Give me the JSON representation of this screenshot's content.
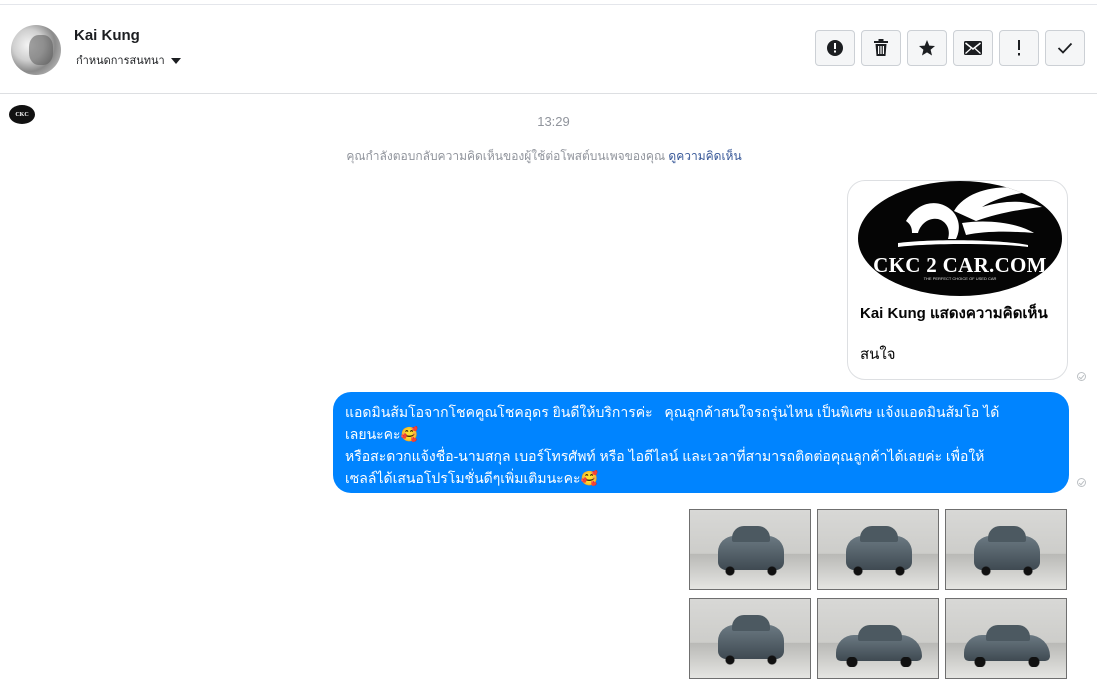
{
  "header": {
    "contact_name": "Kai Kung",
    "subtitle": "กำหนดการสนทนา",
    "actions": [
      {
        "icon": "alert-circle-icon",
        "glyph": "!"
      },
      {
        "icon": "trash-icon"
      },
      {
        "icon": "star-icon"
      },
      {
        "icon": "envelope-icon"
      },
      {
        "icon": "exclamation-icon",
        "glyph": "!"
      },
      {
        "icon": "check-icon"
      }
    ]
  },
  "thread": {
    "page_logo_text": "CKC",
    "timestamp": "13:29",
    "system_message": "คุณกำลังตอบกลับความคิดเห็นของผู้ใช้ต่อโพสต์บนเพจของคุณ",
    "system_link": "ดูความคิดเห็น",
    "comment_card": {
      "logo_text": "CKC 2 CAR.COM",
      "logo_tagline": "THE PERFECT CHOICE OF USED CAR",
      "title": "Kai Kung แสดงความคิดเห็น",
      "body": "สนใจ"
    },
    "reply": {
      "line1": "แอดมินส้มโอจากโชคคูณโชคอุดร ยินดีให้บริการค่ะ   คุณลูกค้าสนใจรถรุ่นไหน เป็นพิเศษ แจ้งแอดมินส้มโอ ได้",
      "line2": "เลยนะคะ🥰",
      "line3": "หรือสะดวกแจ้งชื่อ-นามสกุล เบอร์โทรศัพท์ หรือ ไอดีไลน์ และเวลาที่สามารถติดต่อคุณลูกค้าได้เลยค่ะ เพื่อให้",
      "line4": "เซลล์ได้เสนอโปรโมชั่นดีๆเพิ่มเติมนะคะ🥰"
    },
    "photos": [
      "car-front",
      "car-front-three-quarter",
      "car-rear-three-quarter",
      "car-rear",
      "car-side",
      "car-side-front"
    ]
  },
  "colors": {
    "bubble": "#0084ff",
    "link": "#385898",
    "meta_text": "#90949c"
  }
}
